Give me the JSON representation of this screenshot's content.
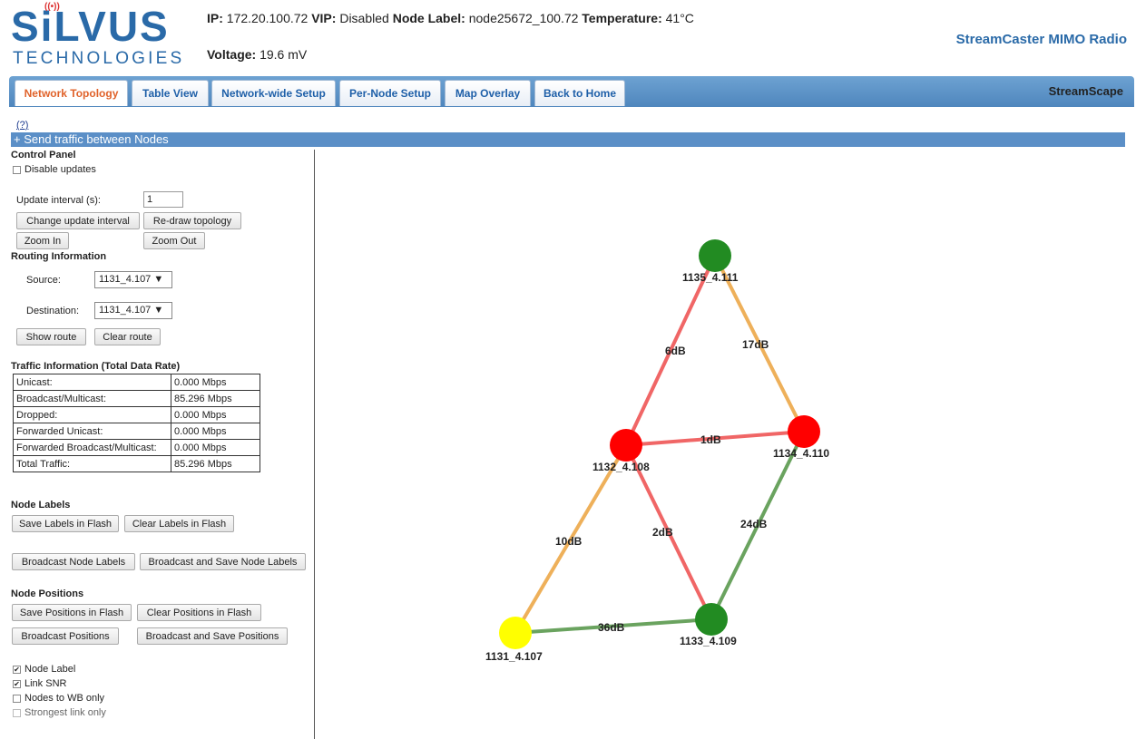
{
  "header": {
    "logo_main": "SiLVUS",
    "logo_sub": "TECHNOLOGIES",
    "ip_label": "IP:",
    "ip_value": "172.20.100.72",
    "vip_label": "VIP:",
    "vip_value": "Disabled",
    "node_label_label": "Node Label:",
    "node_label_value": "node25672_100.72",
    "temp_label": "Temperature:",
    "temp_value": "41°C",
    "voltage_label": "Voltage:",
    "voltage_value": "19.6 mV",
    "product": "StreamCaster MIMO Radio"
  },
  "tabs": [
    {
      "label": "Network Topology",
      "active": true
    },
    {
      "label": "Table View"
    },
    {
      "label": "Network-wide Setup"
    },
    {
      "label": "Per-Node Setup"
    },
    {
      "label": "Map Overlay"
    },
    {
      "label": "Back to Home"
    }
  ],
  "tabbar_right": "StreamScape",
  "help_link": "(?)",
  "send_traffic": "+ Send traffic between Nodes",
  "control_panel": {
    "title": "Control Panel",
    "disable_updates": "Disable updates",
    "update_interval_label": "Update interval (s):",
    "update_interval_value": "1",
    "change_interval": "Change update interval",
    "redraw": "Re-draw topology",
    "zoom_in": "Zoom In",
    "zoom_out": "Zoom Out"
  },
  "routing": {
    "title": "Routing Information",
    "source_label": "Source:",
    "source_value": "1131_4.107 ▼",
    "dest_label": "Destination:",
    "dest_value": "1131_4.107 ▼",
    "show_route": "Show route",
    "clear_route": "Clear route"
  },
  "traffic": {
    "title": "Traffic Information (Total Data Rate)",
    "rows": [
      {
        "name": "Unicast:",
        "value": "0.000 Mbps"
      },
      {
        "name": "Broadcast/Multicast:",
        "value": "85.296 Mbps"
      },
      {
        "name": "Dropped:",
        "value": "0.000 Mbps"
      },
      {
        "name": "Forwarded Unicast:",
        "value": "0.000 Mbps"
      },
      {
        "name": "Forwarded Broadcast/Multicast:",
        "value": "0.000 Mbps"
      },
      {
        "name": "Total Traffic:",
        "value": "85.296 Mbps"
      }
    ]
  },
  "node_labels": {
    "title": "Node Labels",
    "save": "Save Labels in Flash",
    "clear": "Clear Labels in Flash",
    "broadcast": "Broadcast Node Labels",
    "broadcast_save": "Broadcast and Save Node Labels"
  },
  "node_positions": {
    "title": "Node Positions",
    "save": "Save Positions in Flash",
    "clear": "Clear Positions in Flash",
    "broadcast": "Broadcast Positions",
    "broadcast_save": "Broadcast and Save Positions"
  },
  "options": [
    {
      "label": "Node Label",
      "checked": true
    },
    {
      "label": "Link SNR",
      "checked": true
    },
    {
      "label": "Nodes to WB only",
      "checked": false
    },
    {
      "label": "Strongest link only",
      "checked": false,
      "disabled": true
    }
  ],
  "topology": {
    "nodes": [
      {
        "id": "n1135",
        "label": "1135_4.111",
        "color": "#228b22"
      },
      {
        "id": "n1134",
        "label": "1134_4.110",
        "color": "#ff0000"
      },
      {
        "id": "n1132",
        "label": "1132_4.108",
        "color": "#ff0000"
      },
      {
        "id": "n1133",
        "label": "1133_4.109",
        "color": "#228b22"
      },
      {
        "id": "n1131",
        "label": "1131_4.107",
        "color": "#ffff00"
      }
    ],
    "links": [
      {
        "label": "6dB",
        "color": "#f06666"
      },
      {
        "label": "17dB",
        "color": "#eeb05a"
      },
      {
        "label": "1dB",
        "color": "#f06666"
      },
      {
        "label": "2dB",
        "color": "#f06666"
      },
      {
        "label": "24dB",
        "color": "#6aa35f"
      },
      {
        "label": "10dB",
        "color": "#eeb05a"
      },
      {
        "label": "36dB",
        "color": "#6aa35f"
      }
    ]
  }
}
